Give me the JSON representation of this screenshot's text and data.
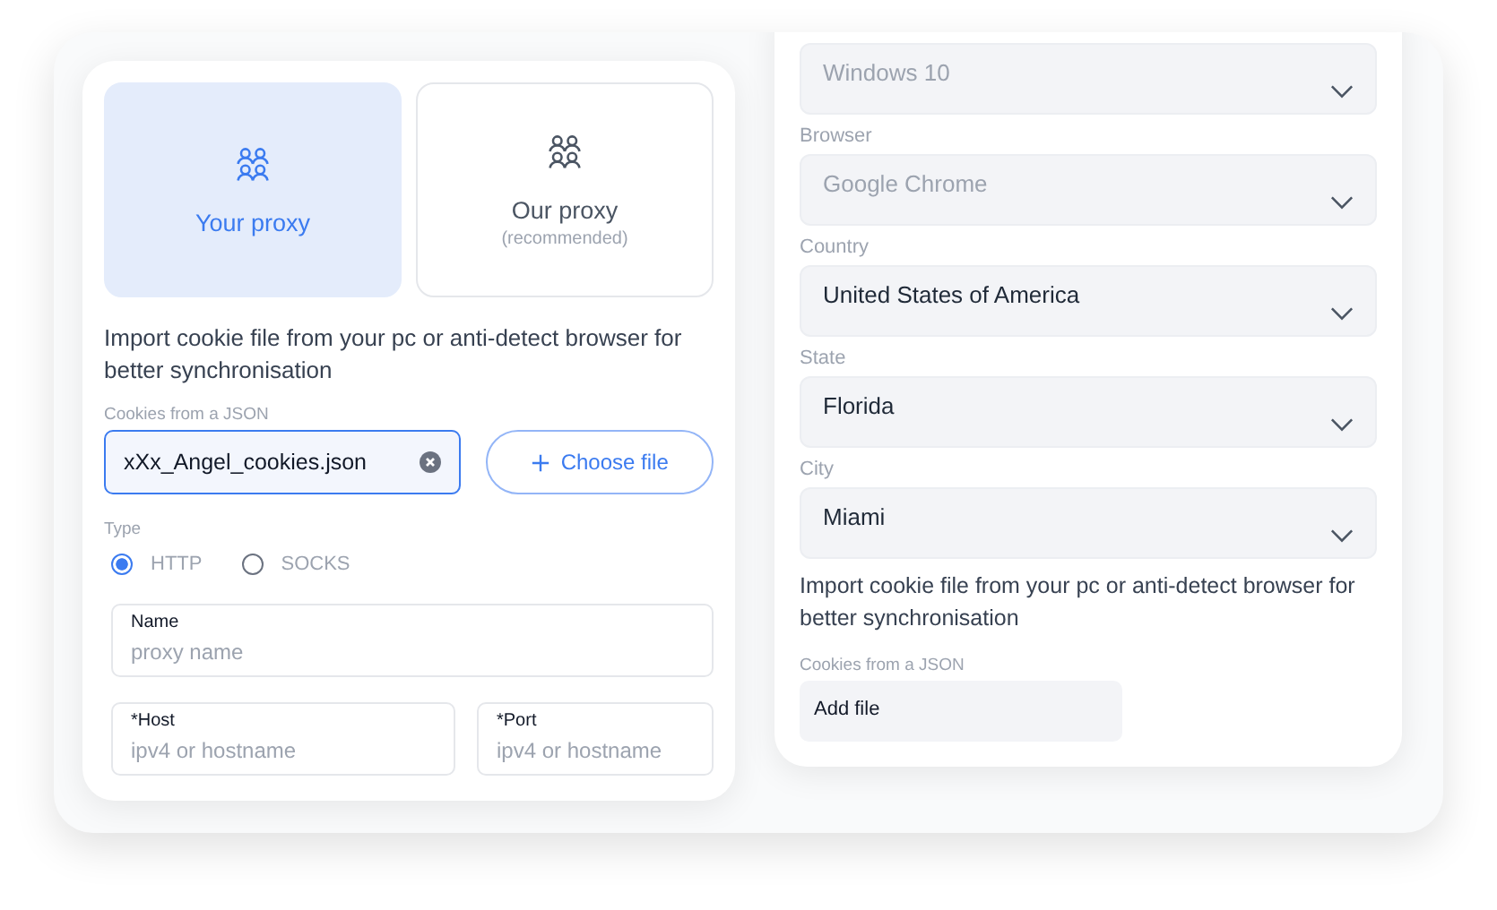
{
  "proxy_form": {
    "proxy_options": [
      {
        "label": "Your proxy",
        "selected": true
      },
      {
        "label": "Our proxy",
        "note": "(recommended)",
        "selected": false
      }
    ],
    "description": "Import cookie file from your pc or anti-detect browser for better synchronisation",
    "cookies": {
      "label": "Cookies from a JSON",
      "value": "xXx_Angel_cookies.json"
    },
    "choose_button": "Choose file",
    "type_label": "Type",
    "types": [
      {
        "label": "HTTP",
        "selected": true
      },
      {
        "label": "SOCKS",
        "selected": false
      }
    ],
    "name_field": {
      "label": "Name",
      "placeholder": "proxy name"
    },
    "host_field": {
      "label": "*Host",
      "placeholder": "ipv4 or hostname"
    },
    "port_field": {
      "label": "*Port",
      "placeholder": "ipv4 or hostname"
    }
  },
  "profile_form": {
    "selects": [
      {
        "placeholder": "Windows 10"
      },
      {
        "label": "Browser",
        "placeholder": "Google Chrome"
      },
      {
        "label": "Country",
        "value": "United States of America"
      },
      {
        "label": "State",
        "value": "Florida"
      },
      {
        "label": "City",
        "value": "Miami"
      }
    ],
    "description": "Import cookie file from your pc or anti-detect browser for better synchronisation",
    "cookies": {
      "label": "Cookies from a JSON",
      "value": "Add file"
    }
  }
}
